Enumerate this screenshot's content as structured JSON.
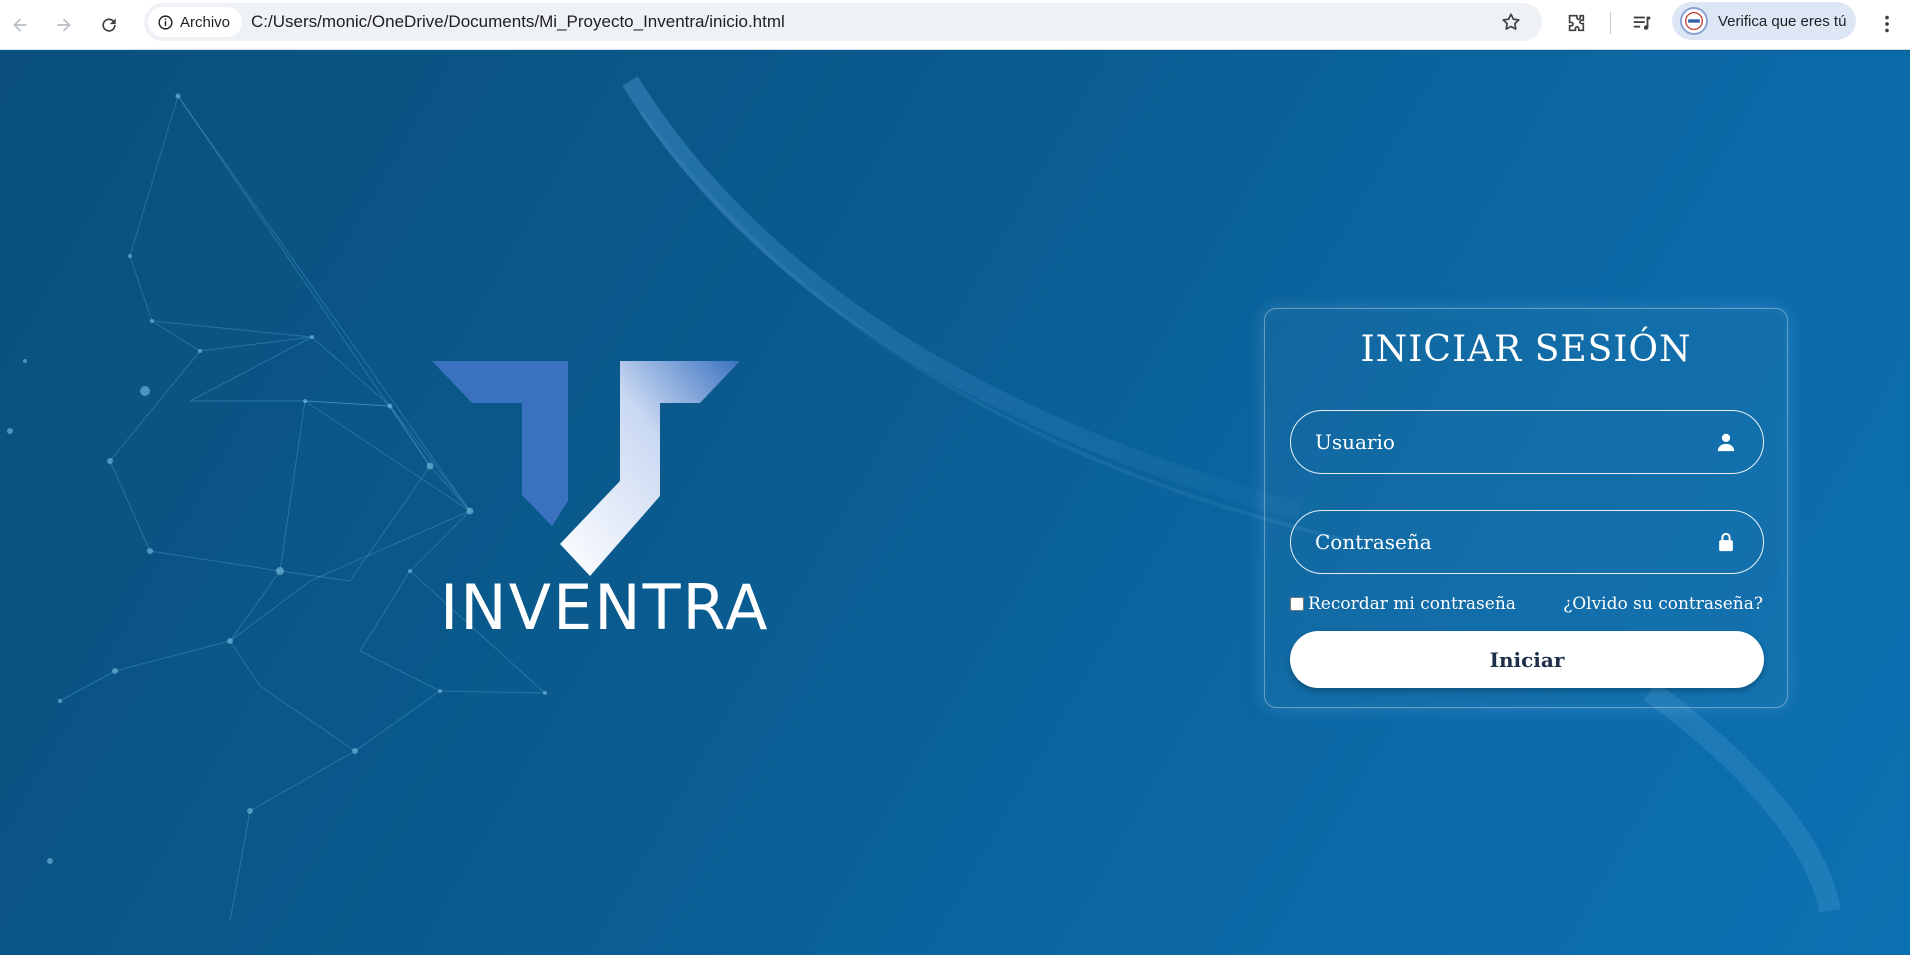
{
  "browser": {
    "site_chip_label": "Archivo",
    "url": "C:/Users/monic/OneDrive/Documents/Mi_Proyecto_Inventra/inicio.html",
    "profile_label": "Verifica que eres tú",
    "icons": [
      "back-icon",
      "forward-icon",
      "reload-icon",
      "info-icon",
      "star-icon",
      "extensions-icon",
      "media-control-icon",
      "kebab-menu-icon"
    ]
  },
  "brand": {
    "name": "INVENTRA",
    "colors": {
      "primary": "#3a72c0",
      "background": "#0a5b8f",
      "text": "#ffffff"
    }
  },
  "login": {
    "title": "INICIAR SESIÓN",
    "username_placeholder": "Usuario",
    "password_placeholder": "Contraseña",
    "remember_label": "Recordar mi contraseña",
    "forgot_label": "¿Olvido su contraseña?",
    "submit_label": "Iniciar"
  }
}
